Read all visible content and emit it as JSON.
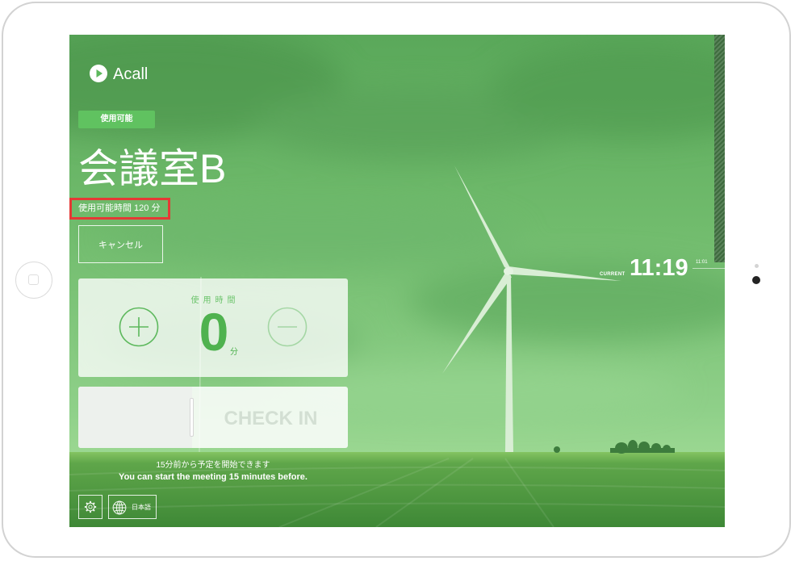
{
  "app": {
    "logo_text": "Acall"
  },
  "room": {
    "status_badge": "使用可能",
    "name": "会議室B",
    "available_time": "使用可能時間 120 分"
  },
  "actions": {
    "cancel_label": "キャンセル"
  },
  "usage": {
    "label": "使用時間",
    "value": "0",
    "unit": "分"
  },
  "checkin": {
    "label": "CHECK IN"
  },
  "clock": {
    "current_label": "CURRENT",
    "current_time": "11:19",
    "timeline_marker": "11:01"
  },
  "notes": {
    "ja": "15分前から予定を開始できます",
    "en": "You can start the meeting 15 minutes before."
  },
  "footer": {
    "language_label": "日本語"
  },
  "icons": {
    "logo": "acall-logo-icon",
    "increment": "plus-circle-icon",
    "decrement": "minus-circle-icon",
    "settings": "gear-icon",
    "language": "globe-icon"
  },
  "colors": {
    "accent": "#5cb85c",
    "badge": "#60c260",
    "highlight": "#e53935"
  }
}
